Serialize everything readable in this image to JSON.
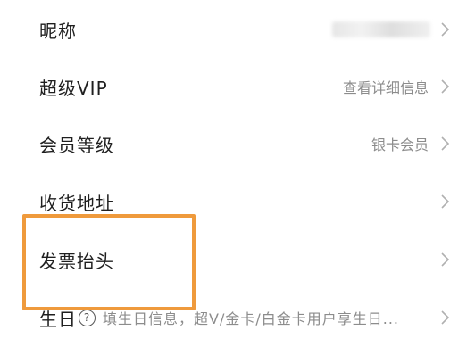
{
  "settings": {
    "nickname": {
      "label": "昵称"
    },
    "vip": {
      "label": "超级VIP",
      "value": "查看详细信息"
    },
    "member_level": {
      "label": "会员等级",
      "value": "银卡会员"
    },
    "address": {
      "label": "收货地址"
    },
    "invoice": {
      "label": "发票抬头"
    },
    "birthday": {
      "label": "生日",
      "hint": "填生日信息，超V/金卡/白金卡用户享生日..."
    }
  },
  "highlight_color": "#ef9a3c",
  "icons": {
    "chevron": "chevron-right-icon",
    "info": "info-circle-icon"
  }
}
